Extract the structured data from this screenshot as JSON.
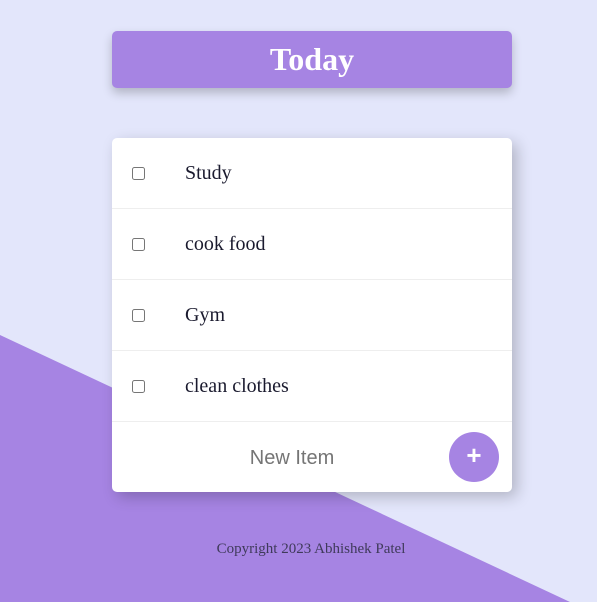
{
  "colors": {
    "background": "#e3e6fb",
    "accent": "#a684e3",
    "card": "#ffffff",
    "text": "#1a1a2e"
  },
  "header": {
    "title": "Today"
  },
  "list": {
    "items": [
      {
        "label": "Study",
        "checked": false
      },
      {
        "label": "cook food",
        "checked": false
      },
      {
        "label": "Gym",
        "checked": false
      },
      {
        "label": "clean clothes",
        "checked": false
      }
    ]
  },
  "new_item": {
    "placeholder": "New Item",
    "value": "",
    "add_button_label": "+",
    "add_button_icon": "plus-icon"
  },
  "footer": {
    "copyright": "Copyright 2023 Abhishek Patel"
  }
}
